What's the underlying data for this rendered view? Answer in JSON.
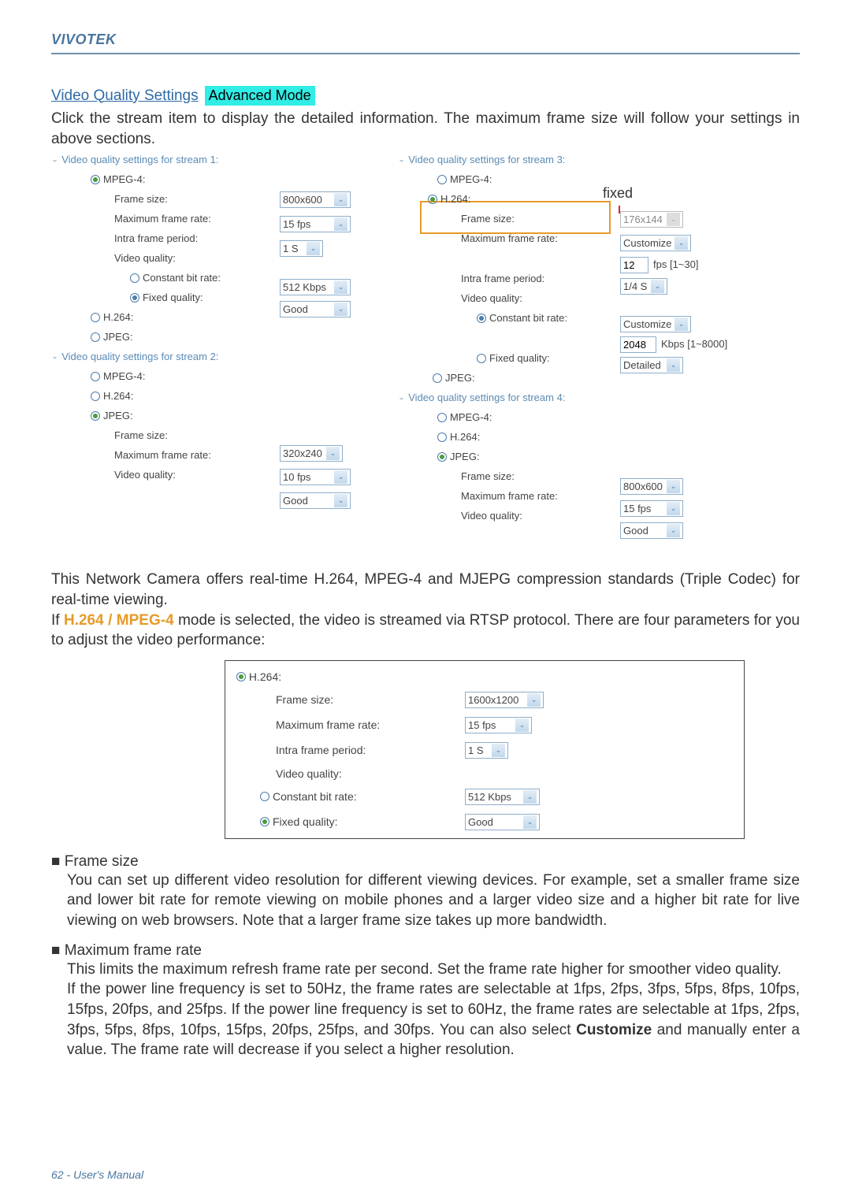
{
  "header": {
    "brand": "VIVOTEK"
  },
  "section": {
    "title": "Video Quality Settings",
    "badge": "Advanced Mode"
  },
  "intro": "Click the stream item to display the detailed information. The maximum frame size will follow your settings in above sections.",
  "callout": {
    "fixed": "fixed"
  },
  "streams": {
    "s1": {
      "heading": "Video quality settings for stream 1:",
      "mpeg4": "MPEG-4:",
      "frame_size_lbl": "Frame size:",
      "frame_size_val": "800x600",
      "max_fr_lbl": "Maximum frame rate:",
      "max_fr_val": "15 fps",
      "intra_lbl": "Intra frame period:",
      "intra_val": "1 S",
      "vq_lbl": "Video quality:",
      "cbr_lbl": "Constant bit rate:",
      "cbr_val": "512 Kbps",
      "fq_lbl": "Fixed quality:",
      "fq_val": "Good",
      "h264": "H.264:",
      "jpeg": "JPEG:"
    },
    "s2": {
      "heading": "Video quality settings for stream 2:",
      "mpeg4": "MPEG-4:",
      "h264": "H.264:",
      "jpeg": "JPEG:",
      "frame_size_lbl": "Frame size:",
      "frame_size_val": "320x240",
      "max_fr_lbl": "Maximum frame rate:",
      "max_fr_val": "10 fps",
      "vq_lbl": "Video quality:",
      "vq_val": "Good"
    },
    "s3": {
      "heading": "Video quality settings for stream 3:",
      "mpeg4": "MPEG-4:",
      "h264": "H.264:",
      "frame_size_lbl": "Frame size:",
      "frame_size_val": "176x144",
      "max_fr_lbl": "Maximum frame rate:",
      "max_fr_val": "Customize",
      "max_fr_input": "12",
      "max_fr_hint": "fps [1~30]",
      "intra_lbl": "Intra frame period:",
      "intra_val": "1/4 S",
      "vq_lbl": "Video quality:",
      "cbr_lbl": "Constant bit rate:",
      "cbr_val": "Customize",
      "cbr_input": "2048",
      "cbr_hint": "Kbps [1~8000]",
      "fq_lbl": "Fixed quality:",
      "fq_val": "Detailed",
      "jpeg": "JPEG:"
    },
    "s4": {
      "heading": "Video quality settings for stream 4:",
      "mpeg4": "MPEG-4:",
      "h264": "H.264:",
      "jpeg": "JPEG:",
      "frame_size_lbl": "Frame size:",
      "frame_size_val": "800x600",
      "max_fr_lbl": "Maximum frame rate:",
      "max_fr_val": "15 fps",
      "vq_lbl": "Video quality:",
      "vq_val": "Good"
    }
  },
  "inset": {
    "h264": "H.264:",
    "fs_lbl": "Frame size:",
    "fs_val": "1600x1200",
    "mfr_lbl": "Maximum frame rate:",
    "mfr_val": "15 fps",
    "intra_lbl": "Intra frame period:",
    "intra_val": "1 S",
    "vq_lbl": "Video quality:",
    "cbr_lbl": "Constant bit rate:",
    "cbr_val": "512 Kbps",
    "fq_lbl": "Fixed quality:",
    "fq_val": "Good"
  },
  "body": {
    "p1": "This Network Camera offers real-time H.264, MPEG-4 and MJEPG compression standards (Triple Codec) for real-time viewing.",
    "p2a": "If ",
    "p2b": "H.264 / MPEG-4",
    "p2c": " mode is selected, the video is streamed via RTSP protocol. There are four parameters for you to adjust the video performance:"
  },
  "bullets": {
    "fs_title": "■ Frame size",
    "fs_body": "You can set up different video resolution for different viewing devices. For example, set a smaller frame size and lower bit rate for remote viewing on mobile phones and a larger video size and a higher bit rate for live viewing on web browsers. Note that a larger frame size takes up more bandwidth.",
    "mfr_title": "■ Maximum frame rate",
    "mfr_body1": "This limits the maximum refresh frame rate per second. Set the frame rate higher for smoother video quality.",
    "mfr_body2a": "If the power line frequency is set to 50Hz, the frame rates are selectable at 1fps, 2fps, 3fps, 5fps, 8fps, 10fps, 15fps, 20fps, and 25fps. If the power line frequency is set to 60Hz, the frame rates are selectable at 1fps, 2fps, 3fps, 5fps, 8fps, 10fps, 15fps, 20fps, 25fps, and 30fps. You can also select ",
    "mfr_body2b": "Customize",
    "mfr_body2c": " and manually enter a value. The frame rate will decrease if you select a higher resolution."
  },
  "footer": {
    "page": "62 - User's Manual"
  }
}
